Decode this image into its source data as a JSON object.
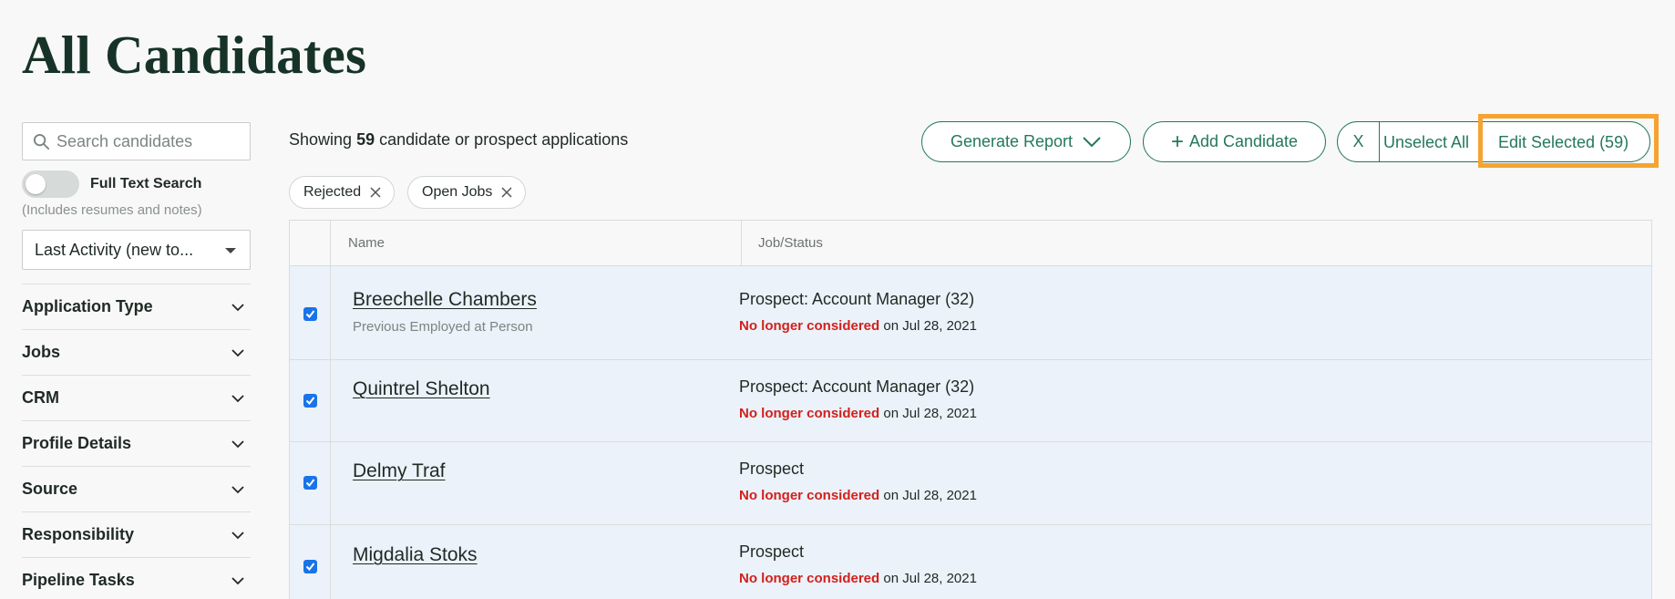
{
  "page": {
    "title": "All Candidates"
  },
  "sidebar": {
    "search_placeholder": "Search candidates",
    "full_text_label": "Full Text Search",
    "full_text_sub": "(Includes resumes and notes)",
    "full_text_on": false,
    "sort_value": "Last Activity (new to...",
    "filters": [
      {
        "label": "Application Type"
      },
      {
        "label": "Jobs"
      },
      {
        "label": "CRM"
      },
      {
        "label": "Profile Details"
      },
      {
        "label": "Source"
      },
      {
        "label": "Responsibility"
      },
      {
        "label": "Pipeline Tasks"
      }
    ]
  },
  "main": {
    "showing_prefix": "Showing",
    "showing_count": "59",
    "showing_suffix": "candidate or prospect applications",
    "buttons": {
      "generate_report": "Generate Report",
      "add_candidate": "Add Candidate",
      "clear": "X",
      "unselect_all": "Unselect All",
      "edit_selected": "Edit Selected (59)"
    },
    "chips": [
      {
        "label": "Rejected"
      },
      {
        "label": "Open Jobs"
      }
    ],
    "table": {
      "headers": {
        "name": "Name",
        "job_status": "Job/Status"
      },
      "rows": [
        {
          "name": "Breechelle Chambers",
          "sub": "Previous Employed at Person",
          "job": "Prospect: Account Manager (32)",
          "status_flag": "No longer considered",
          "status_date": "on Jul 28, 2021",
          "checked": true
        },
        {
          "name": "Quintrel Shelton",
          "sub": "",
          "job": "Prospect: Account Manager (32)",
          "status_flag": "No longer considered",
          "status_date": "on Jul 28, 2021",
          "checked": true
        },
        {
          "name": "Delmy Traf",
          "sub": "",
          "job": "Prospect",
          "status_flag": "No longer considered",
          "status_date": "on Jul 28, 2021",
          "checked": true
        },
        {
          "name": "Migdalia Stoks",
          "sub": "",
          "job": "Prospect",
          "status_flag": "No longer considered",
          "status_date": "on Jul 28, 2021",
          "checked": true
        }
      ]
    }
  },
  "colors": {
    "brand_green": "#24785b",
    "title_green": "#173327",
    "rejected_red": "#d3201b",
    "selected_row": "#ebf2fa",
    "highlight_orange": "#f5a331",
    "checkbox_blue": "#1a73e8"
  }
}
